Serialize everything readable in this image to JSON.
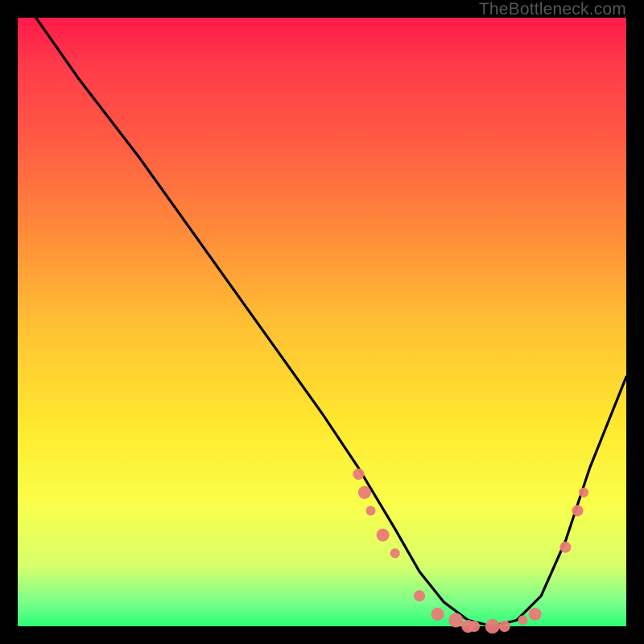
{
  "watermark": "TheBottleneck.com",
  "colors": {
    "background": "#000000",
    "gradient_top": "#ff1a4a",
    "gradient_bottom": "#2bff76",
    "curve": "#000000",
    "scatter": "#e97b78"
  },
  "chart_data": {
    "type": "line",
    "title": "",
    "xlabel": "",
    "ylabel": "",
    "xlim": [
      0,
      100
    ],
    "ylim": [
      0,
      100
    ],
    "series": [
      {
        "name": "curve",
        "x": [
          3,
          10,
          20,
          30,
          40,
          50,
          56,
          62,
          66,
          70,
          74,
          78,
          82,
          86,
          90,
          94,
          100
        ],
        "y": [
          100,
          90,
          77,
          63,
          49,
          35,
          26,
          16,
          9,
          4,
          1,
          0,
          1,
          5,
          14,
          26,
          41
        ]
      }
    ],
    "scatter": [
      {
        "x": 56,
        "y": 25,
        "r": 7
      },
      {
        "x": 57,
        "y": 22,
        "r": 8
      },
      {
        "x": 58,
        "y": 19,
        "r": 6
      },
      {
        "x": 60,
        "y": 15,
        "r": 8
      },
      {
        "x": 62,
        "y": 12,
        "r": 6
      },
      {
        "x": 66,
        "y": 5,
        "r": 7
      },
      {
        "x": 69,
        "y": 2,
        "r": 8
      },
      {
        "x": 72,
        "y": 1,
        "r": 9
      },
      {
        "x": 74,
        "y": 0,
        "r": 8
      },
      {
        "x": 75,
        "y": 0,
        "r": 7
      },
      {
        "x": 78,
        "y": 0,
        "r": 9
      },
      {
        "x": 80,
        "y": 0,
        "r": 7
      },
      {
        "x": 83,
        "y": 1,
        "r": 6
      },
      {
        "x": 85,
        "y": 2,
        "r": 8
      },
      {
        "x": 90,
        "y": 13,
        "r": 7
      },
      {
        "x": 92,
        "y": 19,
        "r": 7
      },
      {
        "x": 93,
        "y": 22,
        "r": 6
      }
    ]
  }
}
